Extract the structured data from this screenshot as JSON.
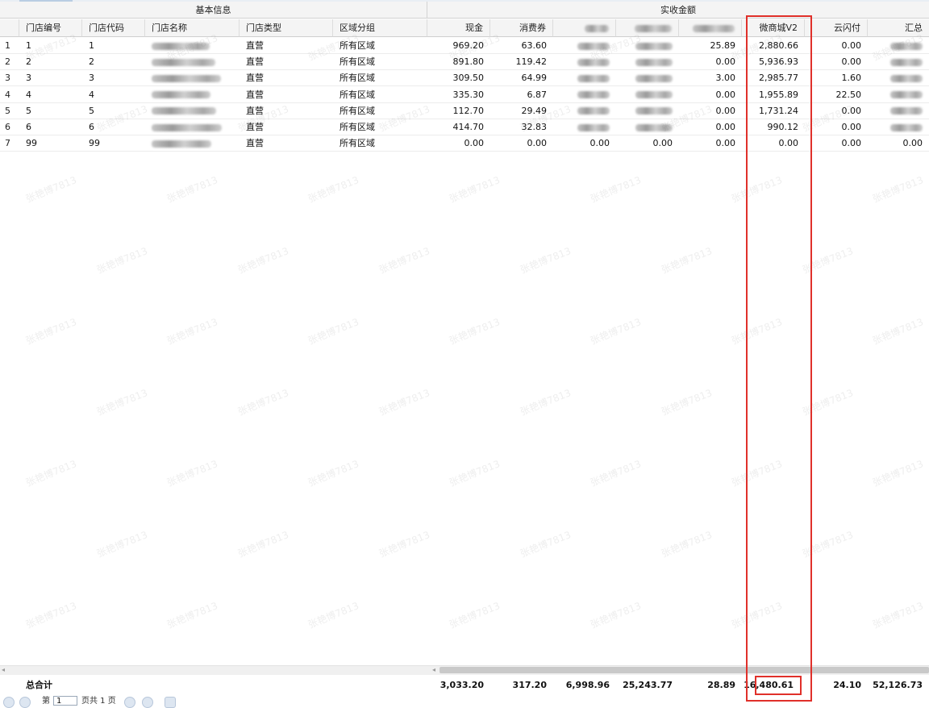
{
  "header": {
    "group_basic": "基本信息",
    "group_amount": "实收金额",
    "columns": {
      "store_no": "门店编号",
      "store_code": "门店代码",
      "store_name": "门店名称",
      "store_type": "门店类型",
      "region": "区域分组",
      "cash": "现金",
      "voucher": "消费券",
      "weimall": "微商城V2",
      "yunshanfu": "云闪付",
      "total": "汇总"
    }
  },
  "rows": [
    {
      "idx": "1",
      "store_no": "1",
      "store_code": "1",
      "store_type": "直营",
      "region": "所有区域",
      "cash": "969.20",
      "voucher": "63.60",
      "c3": "",
      "c4": "",
      "c5": "25.89",
      "weimall": "2,880.66",
      "yunshanfu": "0.00",
      "total": ""
    },
    {
      "idx": "2",
      "store_no": "2",
      "store_code": "2",
      "store_type": "直营",
      "region": "所有区域",
      "cash": "891.80",
      "voucher": "119.42",
      "c3": "",
      "c4": "",
      "c5": "0.00",
      "weimall": "5,936.93",
      "yunshanfu": "0.00",
      "total": ""
    },
    {
      "idx": "3",
      "store_no": "3",
      "store_code": "3",
      "store_type": "直营",
      "region": "所有区域",
      "cash": "309.50",
      "voucher": "64.99",
      "c3": "",
      "c4": "",
      "c5": "3.00",
      "weimall": "2,985.77",
      "yunshanfu": "1.60",
      "total": ""
    },
    {
      "idx": "4",
      "store_no": "4",
      "store_code": "4",
      "store_type": "直营",
      "region": "所有区域",
      "cash": "335.30",
      "voucher": "6.87",
      "c3": "",
      "c4": "",
      "c5": "0.00",
      "weimall": "1,955.89",
      "yunshanfu": "22.50",
      "total": ""
    },
    {
      "idx": "5",
      "store_no": "5",
      "store_code": "5",
      "store_type": "直营",
      "region": "所有区域",
      "cash": "112.70",
      "voucher": "29.49",
      "c3": "",
      "c4": "",
      "c5": "0.00",
      "weimall": "1,731.24",
      "yunshanfu": "0.00",
      "total": ""
    },
    {
      "idx": "6",
      "store_no": "6",
      "store_code": "6",
      "store_type": "直营",
      "region": "所有区域",
      "cash": "414.70",
      "voucher": "32.83",
      "c3": "",
      "c4": "",
      "c5": "0.00",
      "weimall": "990.12",
      "yunshanfu": "0.00",
      "total": ""
    },
    {
      "idx": "7",
      "store_no": "99",
      "store_code": "99",
      "store_type": "直营",
      "region": "所有区域",
      "cash": "0.00",
      "voucher": "0.00",
      "c3": "0.00",
      "c4": "0.00",
      "c5": "0.00",
      "weimall": "0.00",
      "yunshanfu": "0.00",
      "total": "0.00"
    }
  ],
  "totals": {
    "label": "总合计",
    "cash": "3,033.20",
    "voucher": "317.20",
    "c3": "6,998.96",
    "c4": "25,243.77",
    "c5": "28.89",
    "weimall": "16,480.61",
    "yunshanfu": "24.10",
    "total": "52,126.73"
  },
  "pager": {
    "page_prefix": "第",
    "page_value": "1",
    "page_suffix": "页共 1 页"
  },
  "watermark": "张艳博7813",
  "colors": {
    "highlight": "#e0302a",
    "header_bg": "#f4f4f4"
  }
}
